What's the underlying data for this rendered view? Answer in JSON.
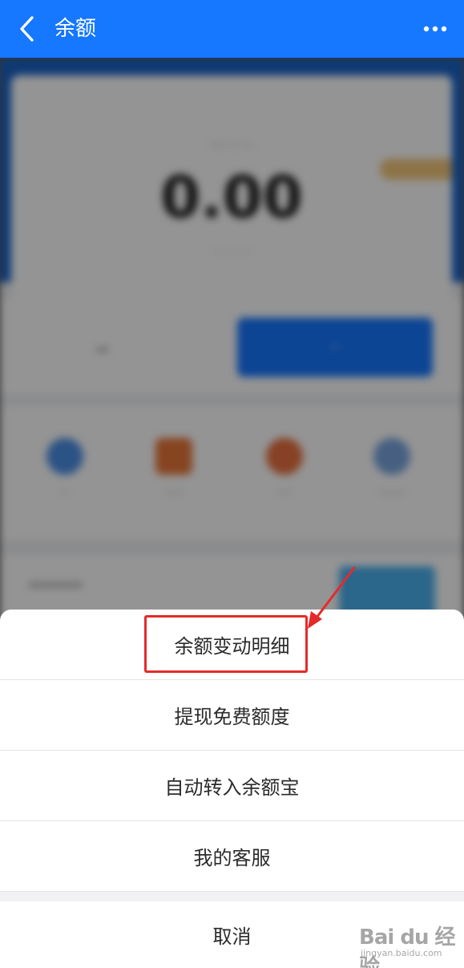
{
  "header": {
    "title": "余额",
    "back_icon": "chevron-left-icon",
    "more_icon": "more-horizontal-icon",
    "color": "#1677ff"
  },
  "background": {
    "balance": "0.00"
  },
  "sheet": {
    "items": [
      {
        "label": "余额变动明细"
      },
      {
        "label": "提现免费额度"
      },
      {
        "label": "自动转入余额宝"
      },
      {
        "label": "我的客服"
      }
    ],
    "cancel_label": "取消"
  },
  "annotation": {
    "highlight_color": "#e52a2a"
  },
  "watermark": {
    "brand": "Bai du 经验",
    "site": "jingyan.baidu.com"
  }
}
